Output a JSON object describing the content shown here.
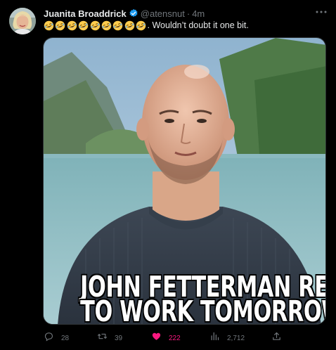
{
  "tweet": {
    "display_name": "Juanita Broaddrick",
    "handle": "@atensnut",
    "separator": "·",
    "time": "4m",
    "emoji_count": 9,
    "emoji": "rolling-on-floor-laughing-emoji",
    "text": ". Wouldn’t doubt it one bit.",
    "image": {
      "caption_line1": "JOHN FETTERMAN RETURNS",
      "caption_line2": "TO WORK TOMORROW"
    },
    "actions": {
      "replies": "28",
      "retweets": "39",
      "likes": "222",
      "views": "2,712"
    }
  },
  "colors": {
    "background": "#000000",
    "text": "#e7e9ea",
    "secondary": "#71767b",
    "verified": "#1d9bf0",
    "like": "#f91880"
  },
  "icons": [
    "verified-badge-icon",
    "more-icon",
    "reply-icon",
    "retweet-icon",
    "like-icon",
    "views-icon",
    "share-icon"
  ]
}
